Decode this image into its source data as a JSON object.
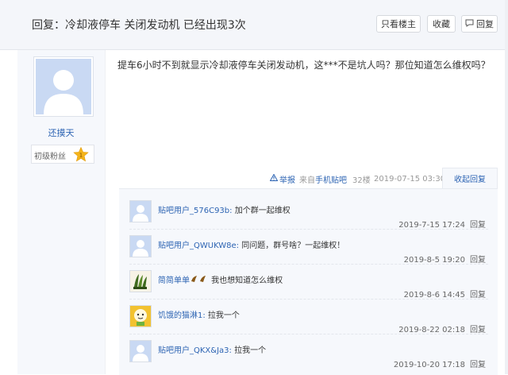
{
  "header": {
    "title": "回复：冷却液停车 关闭发动机 已经出现3次",
    "btn_louzhu": "只看楼主",
    "btn_shoucang": "收藏",
    "btn_huifu": "回复"
  },
  "user": {
    "name": "还摸天",
    "level_name": "初级粉丝",
    "level_number": "1"
  },
  "post": {
    "text": "提车6小时不到就显示冷却液停车关闭发动机，这***不是坑人吗？那位知道怎么维权吗？",
    "report": "举报",
    "source_prefix": "来自",
    "source_link": "手机贴吧",
    "floor": "32楼",
    "time": "2019-07-15 03:30",
    "fold": "收起回复"
  },
  "comments": [
    {
      "name": "贴吧用户_576C93b:",
      "text": " 加个群一起维权",
      "time": "2019-7-15 17:24",
      "reply": "回复",
      "avatar": "default-avatar"
    },
    {
      "name": "贴吧用户_QWUKW8e:",
      "text": " 同问题，群号啥？一起维权！",
      "time": "2019-8-5 19:20",
      "reply": "回复",
      "avatar": "default-avatar"
    },
    {
      "name": "简简单单",
      "text": " 我也想知道怎么维权",
      "time": "2019-8-6 14:45",
      "reply": "回复",
      "avatar": "bananas-avatar"
    },
    {
      "name": "饥饿的猫淋1:",
      "text": " 拉我一个",
      "time": "2019-8-22 02:18",
      "reply": "回复",
      "avatar": "cartoon-avatar"
    },
    {
      "name": "贴吧用户_QKX&Ja3:",
      "text": " 拉我一个",
      "time": "2019-10-20 17:18",
      "reply": "回复",
      "avatar": "default-avatar"
    }
  ],
  "colors": {
    "link": "#2d64b3",
    "header_bg": "#f4f6fa",
    "comment_bg": "#f6f8fc",
    "star": "#f5b41a"
  }
}
